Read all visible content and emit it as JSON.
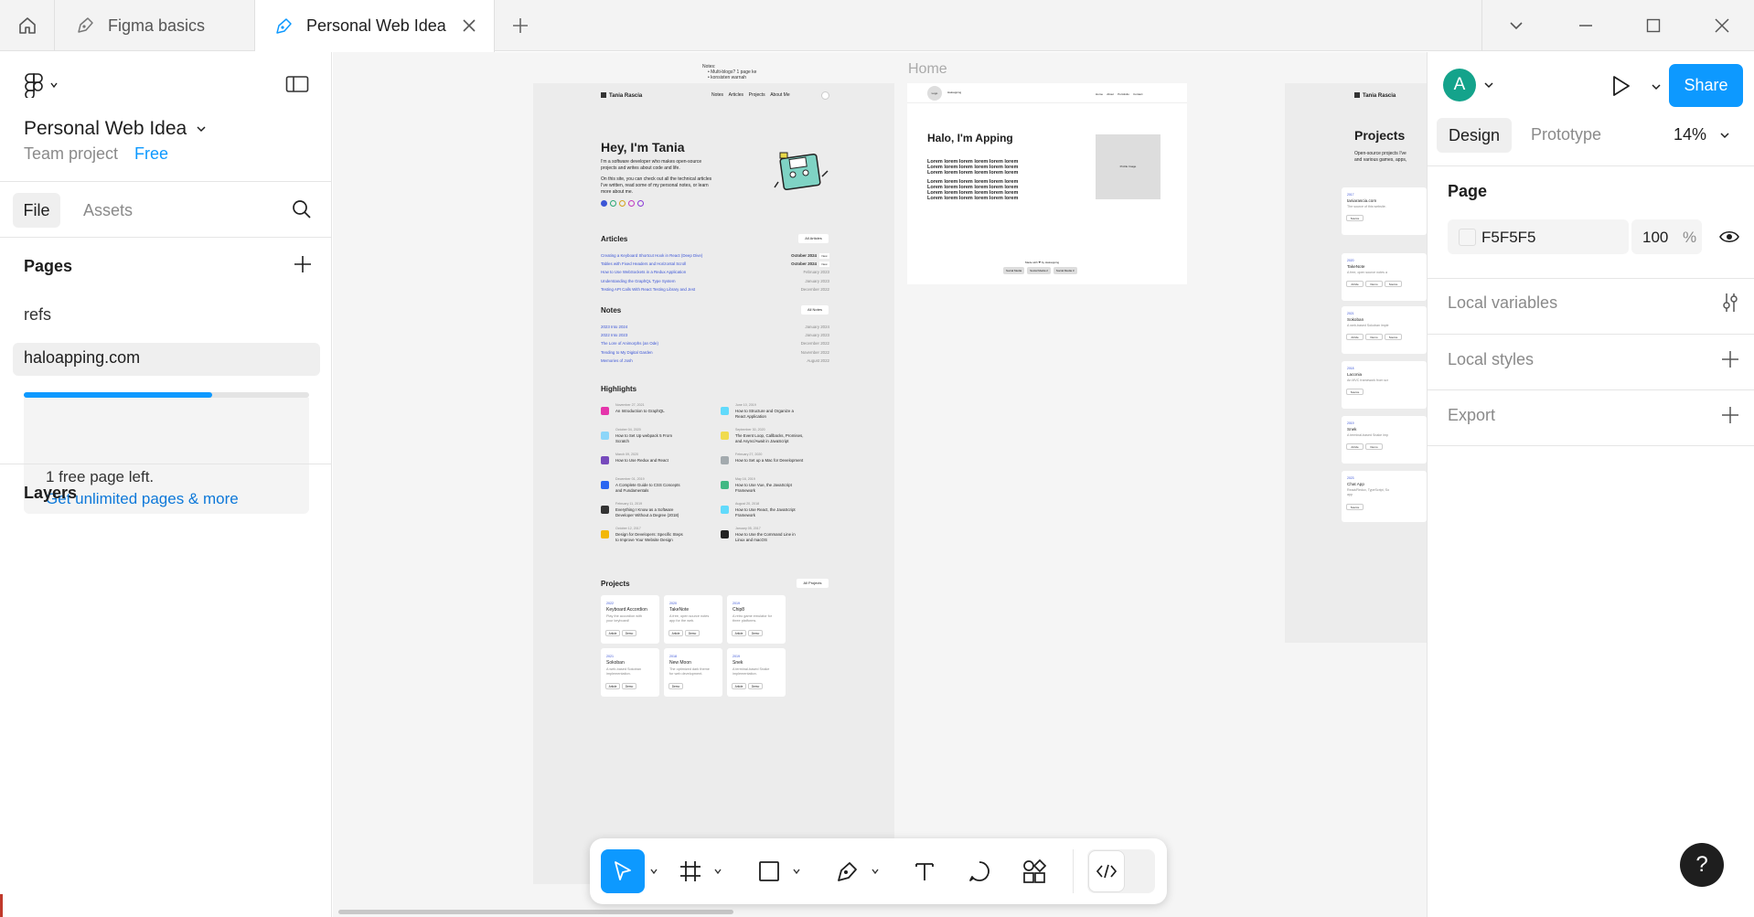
{
  "tabs": {
    "home_label": "Home",
    "items": [
      {
        "label": "Figma basics"
      },
      {
        "label": "Personal Web Idea"
      }
    ]
  },
  "left_panel": {
    "file_title": "Personal Web Idea",
    "team": "Team project",
    "plan": "Free",
    "file_tab": "File",
    "assets_tab": "Assets",
    "pages_heading": "Pages",
    "pages": [
      {
        "label": "refs"
      },
      {
        "label": "haloapping.com"
      }
    ],
    "free_pages_used_fraction": 0.66,
    "upgrade_text": "1 free page left.",
    "upgrade_link": "Get unlimited pages & more",
    "layers_heading": "Layers"
  },
  "canvas": {
    "home_label": "Home",
    "notes_lines": [
      "Notes:",
      "• Multi-blogs? 1 page ke",
      "• konsisten warnah"
    ],
    "frame_a": {
      "brand": "Tania Rascia",
      "nav": [
        "Notes",
        "Articles",
        "Projects",
        "About Me"
      ],
      "hero_title": "Hey, I'm Tania",
      "hero_p1": "I'm a software developer who makes open-source",
      "hero_p2": "projects and writes about code and life.",
      "hero_p3": "On this site, you can check out all the technical articles",
      "hero_p4": "I've written, read some of my personal notes, or learn",
      "hero_p5": "more about me.",
      "articles_heading": "Articles",
      "articles_button": "All Articles",
      "articles": [
        {
          "title": "Creating a Keyboard Shortcut Hook in React (Deep Dive)",
          "date": "October 2024"
        },
        {
          "title": "Tables with Fixed Headers and Horizontal Scroll",
          "date": "October 2024"
        },
        {
          "title": "How to Use WebSockets in a Redux Application",
          "date": "February 2023"
        },
        {
          "title": "Understanding the GraphQL Type System",
          "date": "January 2023"
        },
        {
          "title": "Testing API Calls With React Testing Library and Jest",
          "date": "December 2022"
        }
      ],
      "notes_heading": "Notes",
      "notes_button": "All Notes",
      "notes": [
        {
          "title": "2023 Into 2024",
          "date": "January 2024"
        },
        {
          "title": "2022 Into 2023",
          "date": "January 2023"
        },
        {
          "title": "The Lore of Animorphs (an Ode)",
          "date": "December 2022"
        },
        {
          "title": "Tending to My Digital Garden",
          "date": "November 2022"
        },
        {
          "title": "Memories of Josh",
          "date": "August 2022"
        }
      ],
      "highlights_heading": "Highlights",
      "highlights": [
        {
          "date": "November 27, 2021",
          "title": "An Introduction to GraphQL",
          "title2": ""
        },
        {
          "date": "June 10, 2019",
          "title": "How to Structure and Organize a",
          "title2": "React Application"
        },
        {
          "date": "October 04, 2020",
          "title": "How to Set Up webpack 5 From",
          "title2": "Scratch"
        },
        {
          "date": "September 30, 2020",
          "title": "The Event Loop, Callbacks, Promises,",
          "title2": "and Async/Await in JavaScript"
        },
        {
          "date": "March 09, 2020",
          "title": "How to Use Redux and React",
          "title2": ""
        },
        {
          "date": "February 27, 2020",
          "title": "How to Set up a Mac for Development",
          "title2": ""
        },
        {
          "date": "December 01, 2019",
          "title": "A Complete Guide to CSS Concepts",
          "title2": "and Fundamentals"
        },
        {
          "date": "May 16, 2019",
          "title": "How to Use Vue, the JavaScript",
          "title2": "Framework"
        },
        {
          "date": "February 11, 2019",
          "title": "Everything I Know as a Software",
          "title2": "Developer Without a Degree (2018)"
        },
        {
          "date": "August 20, 2018",
          "title": "How to Use React, the JavaScript",
          "title2": "Framework"
        },
        {
          "date": "October 12, 2017",
          "title": "Design for Developers: Specific Steps",
          "title2": "to Improve Your Website Design"
        },
        {
          "date": "January 05, 2017",
          "title": "How to Use the Command Line in",
          "title2": "Linux and macOS"
        }
      ],
      "projects_heading": "Projects",
      "projects_button": "All Projects",
      "projects": [
        {
          "year": "2022",
          "name": "Keyboard Accordion",
          "d1": "Play the accordion with",
          "d2": "your keyboard!",
          "tags": [
            "Article",
            "Demo"
          ]
        },
        {
          "year": "2020",
          "name": "TakeNote",
          "d1": "A free, open source notes",
          "d2": "app for the web.",
          "tags": [
            "Article",
            "Demo"
          ]
        },
        {
          "year": "2019",
          "name": "Chip8",
          "d1": "A retro game emulator for",
          "d2": "three platforms.",
          "tags": [
            "Article",
            "Demo"
          ]
        },
        {
          "year": "2021",
          "name": "Sokoban",
          "d1": "A web-based Sokoban",
          "d2": "implementation.",
          "tags": [
            "Article",
            "Demo"
          ]
        },
        {
          "year": "2018",
          "name": "New Moon",
          "d1": "The optimized dark theme",
          "d2": "for web development.",
          "tags": [
            "Demo"
          ]
        },
        {
          "year": "2019",
          "name": "Snek",
          "d1": "A terminal-based Snake",
          "d2": "implementation.",
          "tags": [
            "Article",
            "Demo"
          ]
        }
      ]
    },
    "frame_b": {
      "logo": "Logo",
      "brand": "Haloapping",
      "nav": [
        "Home",
        "About",
        "Portofolio",
        "Contact"
      ],
      "title": "Halo, I'm Apping",
      "body_lines": [
        "Lorem lorem lorem lorem lorem lorem",
        "Lorem lorem lorem lorem lorem lorem",
        "Lorem lorem lorem lorem lorem lorem",
        "Lorem lorem lorem lorem lorem lorem",
        "Lorem lorem lorem lorem lorem lorem",
        "Lorem lorem lorem lorem lorem lorem",
        "Lorem lorem lorem lorem lorem lorem"
      ],
      "image_label": "Profile Image",
      "footer_text": "Made with ❤ by Haloapping",
      "footer_buttons": [
        "Social Media",
        "Social Media 2",
        "Social Media 3"
      ]
    },
    "frame_c": {
      "brand": "Tania Rascia",
      "heading": "Projects",
      "intro1": "Open-source projects I've",
      "intro2": "and various games, apps,",
      "items": [
        {
          "year": "2017",
          "name": "taniarascia.com",
          "desc": "The source of this website.",
          "tags": [
            "Source"
          ]
        },
        {
          "year": "2020",
          "name": "TakeNote",
          "desc": "A free, open source notes a",
          "tags": [
            "Article",
            "Demo",
            "Source"
          ]
        },
        {
          "year": "2021",
          "name": "Sokoban",
          "desc": "A web-based Sokoban imple",
          "tags": [
            "Article",
            "Demo",
            "Source"
          ]
        },
        {
          "year": "2018",
          "name": "Laconia",
          "desc": "An MVC framework from scr",
          "tags": [
            "Source"
          ]
        },
        {
          "year": "2019",
          "name": "Snek",
          "desc": "A terminal-based Snake imp",
          "tags": [
            "Article",
            "Demo"
          ]
        },
        {
          "year": "2023",
          "name": "Chat App",
          "desc": "React/Redux, TypeScript, So",
          "desc2": "app",
          "tags": [
            "Source"
          ]
        }
      ]
    }
  },
  "right_panel": {
    "avatar_letter": "A",
    "share_label": "Share",
    "design_tab": "Design",
    "prototype_tab": "Prototype",
    "zoom": "14%",
    "page_heading": "Page",
    "bg_hex": "F5F5F5",
    "bg_opacity": "100",
    "percent": "%",
    "local_variables": "Local variables",
    "local_styles": "Local styles",
    "export": "Export"
  },
  "colors": {
    "accent": "#0d99ff",
    "page_bg": "#F5F5F5",
    "frame_gray": "#ececec",
    "link_blue": "#3b55d6"
  },
  "help_label": "?"
}
